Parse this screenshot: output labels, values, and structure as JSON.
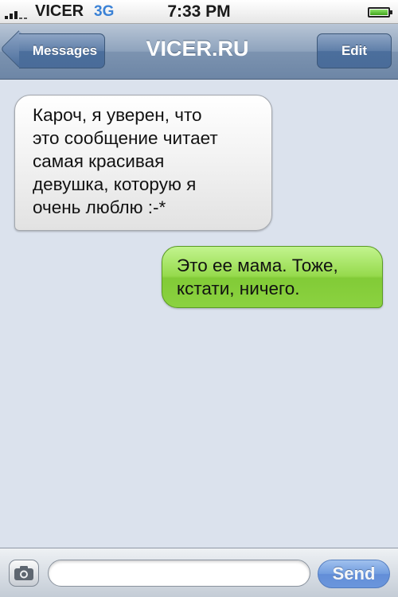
{
  "status_bar": {
    "carrier": "VICER",
    "network": "3G",
    "time": "7:33 PM",
    "battery_level": 0.9
  },
  "nav": {
    "back_label": "Messages",
    "title": "VICER.RU",
    "edit_label": "Edit"
  },
  "messages": [
    {
      "direction": "received",
      "text": "Кароч, я уверен, что\nэто сообщение читает\nсамая красивая\nдевушка, которую я\nочень люблю :-*"
    },
    {
      "direction": "sent",
      "text": "Это ее мама. Тоже,\nкстати, ничего."
    }
  ],
  "input_bar": {
    "camera_icon": "camera-icon",
    "text_value": "",
    "send_label": "Send"
  },
  "colors": {
    "background": "#dbe2ed",
    "sent_bubble": "#8bd240",
    "received_bubble": "#f3f3f3",
    "nav_bar": "#7c93b0",
    "send_button": "#4a82dd"
  }
}
